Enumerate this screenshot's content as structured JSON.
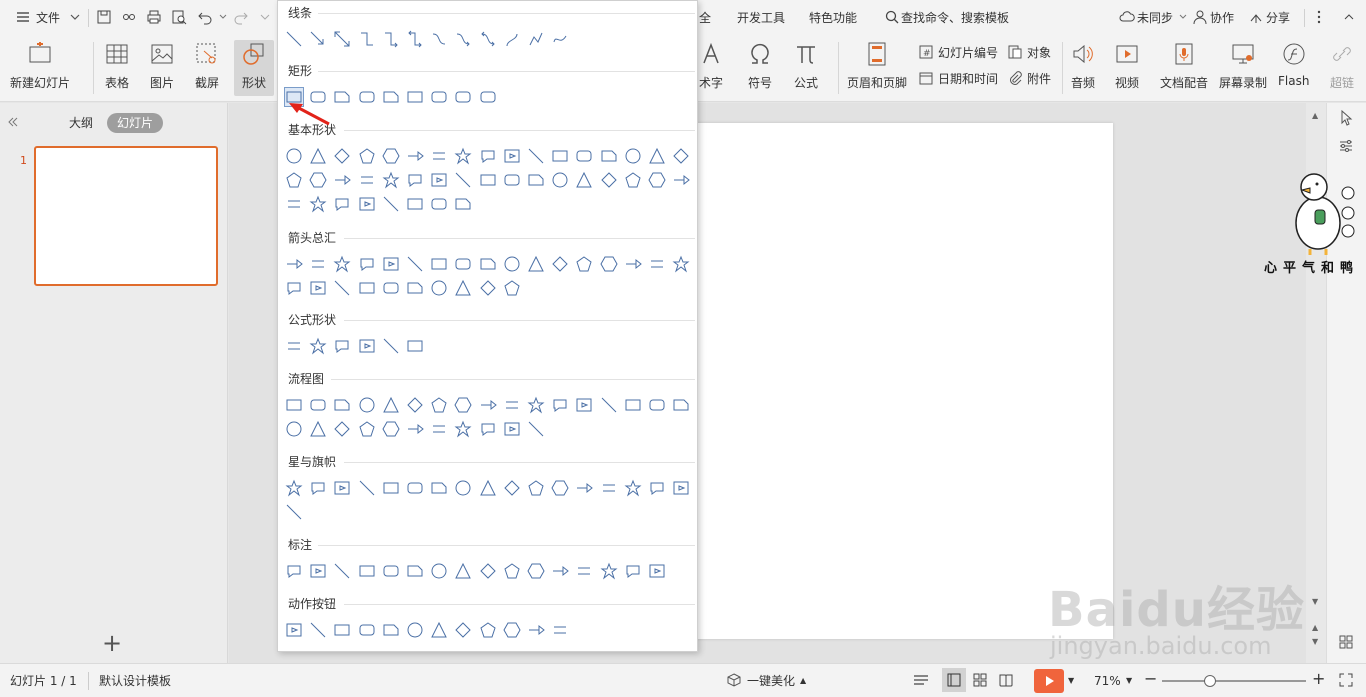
{
  "topbar": {
    "menu_label": "文件",
    "tabs": [
      "全",
      "开发工具",
      "特色功能"
    ],
    "search_placeholder": "查找命令、搜索模板",
    "sync": "未同步",
    "collab": "协作",
    "share": "分享"
  },
  "ribbon": {
    "new_slide": "新建幻灯片",
    "table": "表格",
    "picture": "图片",
    "screenshot": "截屏",
    "shape": "形状",
    "art": "术字",
    "symbol": "符号",
    "formula": "公式",
    "header_footer": "页眉和页脚",
    "slide_number": "幻灯片编号",
    "datetime": "日期和时间",
    "object": "对象",
    "attachment": "附件",
    "audio": "音频",
    "video": "视频",
    "narration": "文档配音",
    "screen_record": "屏幕录制",
    "flash": "Flash",
    "hyperlink": "超链"
  },
  "left_panel": {
    "tab_outline": "大纲",
    "tab_slides": "幻灯片",
    "slide_number": "1",
    "add": "+"
  },
  "shape_panel": {
    "sections": [
      {
        "title": "线条",
        "count": 12
      },
      {
        "title": "矩形",
        "count": 9
      },
      {
        "title": "基本形状",
        "count": 42
      },
      {
        "title": "箭头总汇",
        "count": 27
      },
      {
        "title": "公式形状",
        "count": 6
      },
      {
        "title": "流程图",
        "count": 28
      },
      {
        "title": "星与旗帜",
        "count": 18
      },
      {
        "title": "标注",
        "count": 16
      },
      {
        "title": "动作按钮",
        "count": 12
      }
    ],
    "selected": "矩形"
  },
  "statusbar": {
    "slide_info": "幻灯片 1 / 1",
    "template": "默认设计模板",
    "beautify": "一键美化",
    "zoom": "71%"
  },
  "watermark": {
    "baidu": "Baidu经验",
    "url": "jingyan.baidu.com",
    "duck_caption": "心平气和鸭"
  },
  "colors": {
    "accent": "#e06c2c",
    "shape_stroke": "#4a6fa5",
    "play": "#f0643c"
  }
}
